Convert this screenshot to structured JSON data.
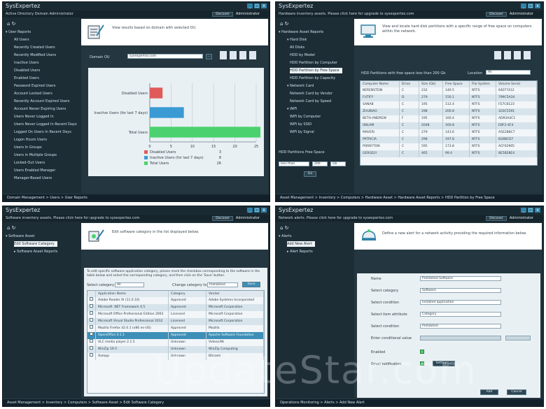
{
  "app_title": "SysExpertez",
  "colors": {
    "accent": "#2f82a8",
    "chrome": "#1d2d36",
    "bar_red": "#e05a5a",
    "bar_blue": "#3a9ad4",
    "bar_green": "#4bd26e"
  },
  "window_buttons": [
    "_",
    "□",
    "x"
  ],
  "windows": {
    "top_left": {
      "info_text": "Active Directory Domain Administrator",
      "info_btn": "Discover",
      "info_menu": "Administrator",
      "nav_root": "User Reports",
      "nav_items": [
        "All Users",
        "Recently Created Users",
        "Recently Modified Users",
        "Inactive Users",
        "Disabled Users",
        "Enabled Users",
        "Password Expired Users",
        "Account Locked Users",
        "Recently Account Expired Users",
        "Account Never Expiring Users",
        "Users Never Logged In",
        "Users Never Logged In Recent Days",
        "Logged On Users In Recent Days",
        "Logon Hours Users",
        "Users In Groups",
        "Users in Multiple Groups",
        "Locked-Out Users",
        "Users Enabled Manager",
        "Manager-Based Users"
      ],
      "header_text": "View results based on domain with selected OU.",
      "domain_label": "Domain OU",
      "domain_value": "sysexpertez.com",
      "chart_title": "",
      "status": "Domain Management > Users > User Reports"
    },
    "top_right": {
      "info_text": "Hardware inventory assets. Please click here for upgrade to sysexpertez.com",
      "info_btn": "Discover",
      "info_menu": "Administrator",
      "nav_root": "Hardware Asset Reports",
      "nav_groups": [
        {
          "label": "Hard Disk",
          "items": [
            "All Disks",
            "HDD by Model",
            "HDD Partition by Computer",
            "HDD Partition by Free Space",
            "HDD Partition by Capacity"
          ]
        },
        {
          "label": "Network Card",
          "items": [
            "Network Card by Vendor",
            "Network Card by Speed"
          ]
        },
        {
          "label": "WiFi",
          "items": [
            "WiFi by Computer",
            "WiFi by SSID",
            "WiFi by Signal"
          ]
        }
      ],
      "header_text": "View and locate hard disk partitions with a specific range of free space on computers within the network.",
      "filter_text": "HDD Partitions with free space less than 200 Gb",
      "location_label": "Location",
      "location_value": "All",
      "table_headers": [
        "Computer Name",
        "Drive",
        "Size (Gb)",
        "Free Space",
        "File System",
        "Volume Serial"
      ],
      "table_rows": [
        [
          "BERENSTEIN",
          "C",
          "232",
          "146.5",
          "NTFS",
          "64EF7412"
        ],
        [
          "FUTIFY",
          "D",
          "279",
          "150.1",
          "NTFS",
          "799C5A34"
        ],
        [
          "SANAB",
          "C",
          "195",
          "112.4",
          "NTFS",
          "FE7C8123"
        ],
        [
          "ZHUBIAO",
          "C",
          "298",
          "200.8",
          "NTFS",
          "1E0C5591"
        ],
        [
          "BETH-ANDREW",
          "F",
          "195",
          "160.4",
          "NTFS",
          "AD93A4C1"
        ],
        [
          "UNLAM",
          "C",
          "2048",
          "160.8",
          "NTFS",
          "EBF2-4F4"
        ],
        [
          "MAVERI",
          "C",
          "279",
          "143.6",
          "NTFS",
          "A5E2B8C7"
        ],
        [
          "PATRICIA",
          "C",
          "298",
          "197.8",
          "NTFS",
          "B28BCD7"
        ],
        [
          "PORKYTON",
          "C",
          "595",
          "173.8",
          "NTFS",
          "ACF62905"
        ],
        [
          "GERGELY",
          "C",
          "465",
          "99.4",
          "NTFS",
          "8E5B28E4"
        ]
      ],
      "bottom_label": "HDD Partitions Free Space",
      "bottom_select": "less than",
      "bottom_value": "200",
      "bottom_unit": "Gb",
      "go_button": "Go",
      "status": "Asset Management > Inventory > Computers > Hardware Asset > Hardware Asset Reports > HDD Partition by Free Space"
    },
    "bottom_left": {
      "info_text": "Software inventory assets. Please click here for upgrade to sysexpertez.com",
      "info_btn": "Discover",
      "info_menu": "Administrator",
      "nav_root": "Software Asset",
      "nav_items": [
        "Edit Software Category",
        "Software Asset Reports"
      ],
      "header_text": "Edit software category in the list displayed below.",
      "instructions": "To edit specific software application category, please mark the checkbox corresponding to the software in the table below and select the corresponding category, and then click on the 'Save' button.",
      "select_cat_label": "Select category",
      "select_cat_value": "All",
      "change_label": "Change category to",
      "change_value": "Prohibited",
      "save_button": "Save",
      "table_headers": [
        "",
        "Application Name",
        "Category",
        "Vendor"
      ],
      "table_rows": [
        [
          "",
          "Adobe Reader XI (11.0.10)",
          "Approved",
          "Adobe Systems Incorporated"
        ],
        [
          "",
          "Microsoft .NET Framework 4.5",
          "Approved",
          "Microsoft Corporation"
        ],
        [
          "",
          "Microsoft Office Professional Edition 2003",
          "Licensed",
          "Microsoft Corporation"
        ],
        [
          "",
          "Microsoft Visual Studio Professional 2012",
          "Licensed",
          "Microsoft Corporation"
        ],
        [
          "",
          "Mozilla Firefox 42.0.1 (x86 en-US)",
          "Approved",
          "Mozilla"
        ],
        [
          "",
          "OpenOffice 4.1.1",
          "Approved",
          "Apache Software Foundation"
        ],
        [
          "",
          "VLC media player 2.1.5",
          "Unknown",
          "VideoLAN"
        ],
        [
          "",
          "WinZip 19.5",
          "Unknown",
          "WinZip Computing"
        ],
        [
          "",
          "Xampp",
          "Unknown",
          "Bitnami"
        ]
      ],
      "status": "Asset Management > Inventory > Computers > Software Asset > Edit Software Category"
    },
    "bottom_right": {
      "info_text": "Network alerts. Please click here for upgrade to sysexpertez.com",
      "info_btn": "Discover",
      "info_menu": "Administrator",
      "nav_root": "Alerts",
      "nav_items": [
        "Add New Alert",
        "Alert Reports"
      ],
      "header_text": "Define a new alert for a network activity providing the required information below.",
      "form": [
        {
          "label": "Name",
          "value": "Prohibited Software"
        },
        {
          "label": "Select category",
          "value": "Software"
        },
        {
          "label": "Select condition",
          "value": "Installed application"
        },
        {
          "label": "Select item attribute",
          "value": "Category"
        },
        {
          "label": "Select condition",
          "value": "Prohibited"
        },
        {
          "label": "Enter conditional value",
          "value": ""
        }
      ],
      "enabled_label": "Enabled",
      "email_label": "Email notification",
      "settings_button": "Settings...",
      "add_button": "Add",
      "cancel_button": "Cancel",
      "status": "Operations Monitoring > Alerts > Add New Alert"
    }
  },
  "chart_data": {
    "type": "bar",
    "categories": [
      "Disabled Users",
      "Inactive Users (for last 7 days)",
      "Total Users"
    ],
    "values": [
      3,
      8,
      26
    ],
    "xlim": [
      0,
      25
    ],
    "xticks": [
      0,
      5,
      10,
      15,
      20,
      25
    ],
    "legend": [
      {
        "name": "Disabled Users",
        "value": 3
      },
      {
        "name": "Inactive Users (for last 7 days)",
        "value": 8
      },
      {
        "name": "Total Users",
        "value": 26
      }
    ],
    "grid": true,
    "legend_position": "bottom"
  },
  "watermark": "UpdateStar.com"
}
